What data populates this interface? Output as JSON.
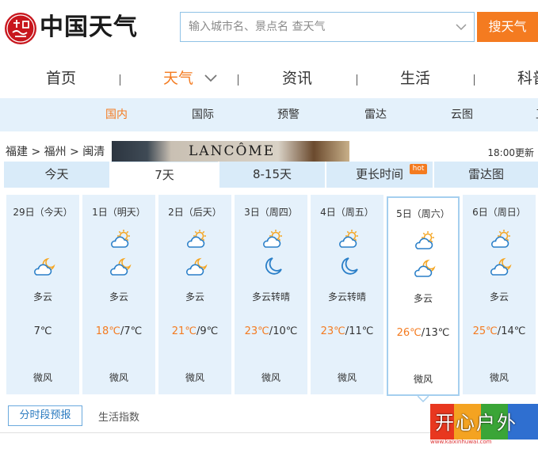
{
  "brand": {
    "name": "中国天气",
    "seal_text": "中国天气"
  },
  "search": {
    "placeholder": "输入城市名、景点名 查天气",
    "button": "搜天气"
  },
  "main_nav": [
    "首页",
    "天气",
    "资讯",
    "生活",
    "科普"
  ],
  "main_nav_active": "天气",
  "sub_nav": [
    "国内",
    "国际",
    "预警",
    "雷达",
    "云图",
    "卫"
  ],
  "sub_nav_active": "国内",
  "breadcrumb": "福建 > 福州 > 闽清",
  "ad": {
    "text": "LANCÔME"
  },
  "update_time": "18:00更新",
  "forecast_tabs": [
    "今天",
    "7天",
    "8-15天",
    "更长时间",
    "雷达图"
  ],
  "forecast_tab_active": "7天",
  "hot_badge": "hot",
  "days": [
    {
      "date": "29日（今天）",
      "icons": [
        "partly-cloudy-night-icon"
      ],
      "weather": "多云",
      "high": "",
      "low": "7℃",
      "wind": "微风"
    },
    {
      "date": "1日（明天）",
      "icons": [
        "partly-cloudy-day-icon",
        "partly-cloudy-night-icon"
      ],
      "weather": "多云",
      "high": "18℃",
      "low": "7℃",
      "wind": "微风"
    },
    {
      "date": "2日（后天）",
      "icons": [
        "partly-cloudy-day-icon",
        "partly-cloudy-night-icon"
      ],
      "weather": "多云",
      "high": "21℃",
      "low": "9℃",
      "wind": "微风"
    },
    {
      "date": "3日（周四）",
      "icons": [
        "partly-cloudy-day-icon",
        "moon-icon"
      ],
      "weather": "多云转晴",
      "high": "23℃",
      "low": "10℃",
      "wind": "微风"
    },
    {
      "date": "4日（周五）",
      "icons": [
        "partly-cloudy-day-icon",
        "moon-icon"
      ],
      "weather": "多云转晴",
      "high": "23℃",
      "low": "11℃",
      "wind": "微风"
    },
    {
      "date": "5日（周六）",
      "icons": [
        "partly-cloudy-day-icon",
        "partly-cloudy-night-icon"
      ],
      "weather": "多云",
      "high": "26℃",
      "low": "13℃",
      "wind": "微风"
    },
    {
      "date": "6日（周日）",
      "icons": [
        "partly-cloudy-day-icon",
        "partly-cloudy-night-icon"
      ],
      "weather": "多云",
      "high": "25℃",
      "low": "14℃",
      "wind": "微风"
    }
  ],
  "selected_day_index": 5,
  "bottom_tabs": [
    "分时段预报",
    "生活指数"
  ],
  "bottom_tab_active": "分时段预报",
  "watermark": {
    "text": "开心户外",
    "url": "www.kaixinhuwai.com"
  },
  "colors": {
    "accent": "#f47b20",
    "tab_bg": "#d9ebf9",
    "card_bg": "#e5f1fb",
    "icon_stroke": "#2a7fc8",
    "sun": "#f5a623"
  }
}
